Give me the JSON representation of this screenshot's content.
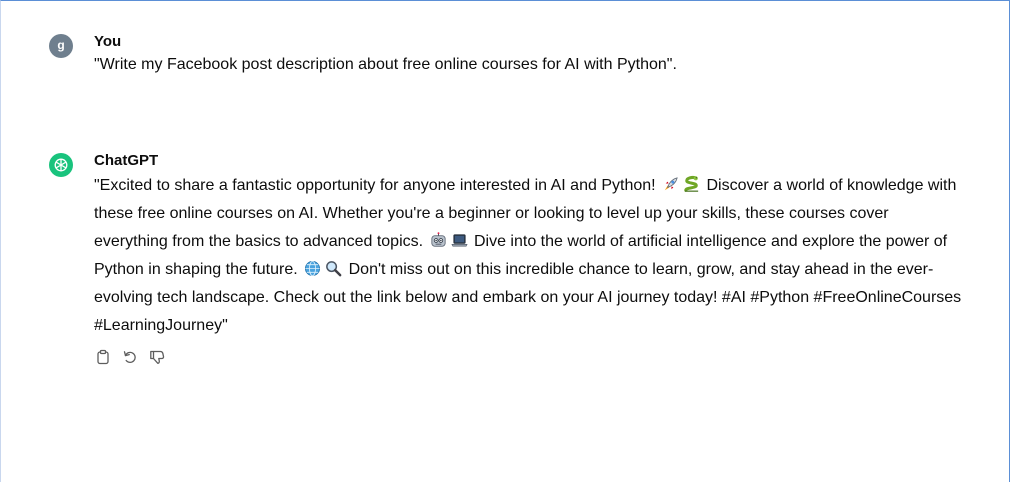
{
  "user_message": {
    "avatar_initial": "g",
    "author": "You",
    "text": "\"Write my Facebook post description about free online courses for AI with Python\"."
  },
  "assistant_message": {
    "author": "ChatGPT",
    "segments": {
      "s1": "\"Excited to share a fantastic opportunity for anyone interested in AI and Python!",
      "s2": "Discover a world of knowledge with these free online courses on AI. Whether you're a beginner or looking to level up your skills, these courses cover everything from the basics to advanced topics.",
      "s3": "Dive into the world of artificial intelligence and explore the power of Python in shaping the future.",
      "s4": "Don't miss out on this incredible chance to learn, grow, and stay ahead in the ever-evolving tech landscape. Check out the link below and embark on your AI journey today! #AI #Python #FreeOnlineCourses #LearningJourney\""
    },
    "emojis": [
      "rocket-icon",
      "snake-icon",
      "robot-icon",
      "laptop-icon",
      "globe-icon",
      "magnifier-icon"
    ],
    "actions": [
      "copy-icon",
      "regenerate-icon",
      "thumbs-down-icon"
    ]
  },
  "colors": {
    "chatgpt_avatar": "#19c37d",
    "user_avatar": "#6f7f8e",
    "frame_border": "#5b8fd6"
  }
}
